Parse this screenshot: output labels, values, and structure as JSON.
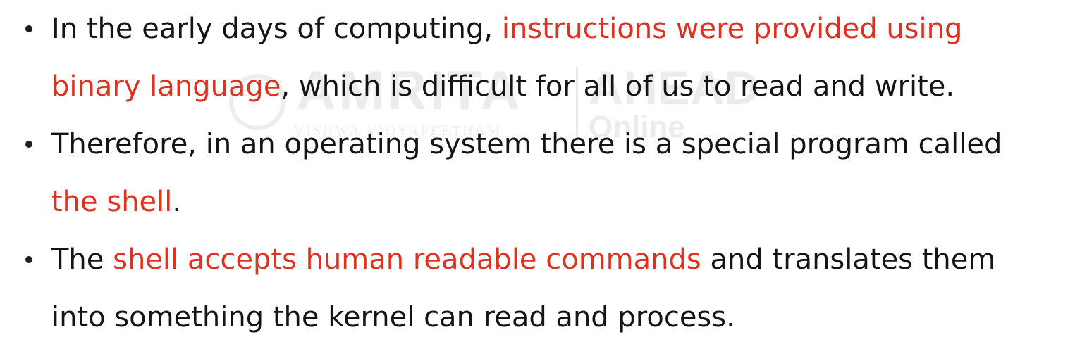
{
  "watermark": {
    "name": "AMRITA",
    "subtitle": "VISHWA VIDYAPEETHAM",
    "brand": "AHEAD",
    "tagline": "Online"
  },
  "colors": {
    "text": "#141414",
    "highlight": "#e0301e",
    "background": "#ffffff"
  },
  "bullets": [
    {
      "line1_a": "In the early days of computing, ",
      "line1_hl": "instructions were provided using",
      "line2_hl": "binary language",
      "line2_b": ", which is difficult for all of us to read and write."
    },
    {
      "line1_a": "Therefore, in an operating system there is a special program called",
      "line2_hl": "the shell",
      "line2_b": "."
    },
    {
      "line1_a": "The ",
      "line1_hl": "shell accepts human readable commands",
      "line1_b": " and translates them",
      "line2_a": "into something the kernel can read and process."
    }
  ]
}
